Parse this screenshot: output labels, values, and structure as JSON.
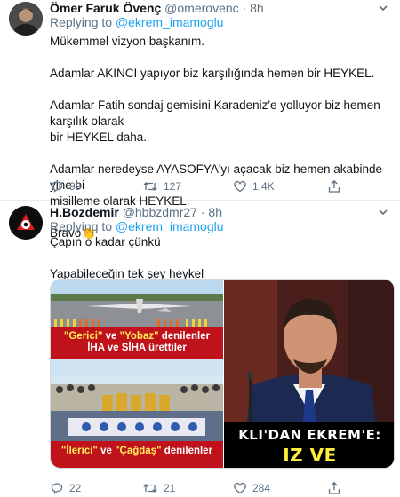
{
  "tweets": [
    {
      "name": "Ömer Faruk Övenç",
      "handle": "@omerovenc",
      "separator": "·",
      "time": "8h",
      "replying_prefix": "Replying to",
      "replying_to": "@ekrem_imamoglu",
      "lines": [
        "Mükemmel vizyon başkanım.",
        "",
        "Adamlar AKINCI yapıyor biz karşılığında hemen bir HEYKEL.",
        "",
        "Adamlar Fatih sondaj gemisini Karadeniz'e yolluyor biz hemen karşılık olarak",
        "bir HEYKEL daha.",
        "",
        "Adamlar neredeyse AYASOFYA'yı açacak biz hemen akabinde yine bi",
        "misilleme olarak HEYKEL.",
        "",
        "Bravo👏"
      ],
      "counts": {
        "reply": "99",
        "retweet": "127",
        "like": "1.4K"
      }
    },
    {
      "name": "H.Bozdemir",
      "handle": "@hbbzdmr27",
      "separator": "·",
      "time": "8h",
      "replying_prefix": "Replying to",
      "replying_to": "@ekrem_imamoglu",
      "lines": [
        "Çapın o kadar çünkü",
        "",
        "Yapabileceğin tek şey heykel"
      ],
      "media": {
        "left_top_caption_q1": "\"Gerici\"",
        "left_top_caption_ve": "ve",
        "left_top_caption_q2": "\"Yobaz\"",
        "left_top_caption_rest": "denilenler",
        "left_top_caption_line2": "İHA ve SİHA ürettiler",
        "left_bottom_caption_q1": "\"İlerici\"",
        "left_bottom_caption_ve": "ve",
        "left_bottom_caption_q2": "\"Çağdaş\"",
        "left_bottom_caption_rest": "denilenler",
        "right_banner_line1": "KLI'DAN EKREM'E:",
        "right_banner_line2": "IZ VE ÇAPSIZSIN!"
      },
      "counts": {
        "reply": "22",
        "retweet": "21",
        "like": "284"
      }
    }
  ],
  "colors": {
    "accent": "#1da1f2",
    "muted": "#5b7083",
    "caption_red": "#c0121b"
  },
  "icons": [
    "reply-icon",
    "retweet-icon",
    "like-icon",
    "share-icon",
    "caret-down-icon"
  ]
}
